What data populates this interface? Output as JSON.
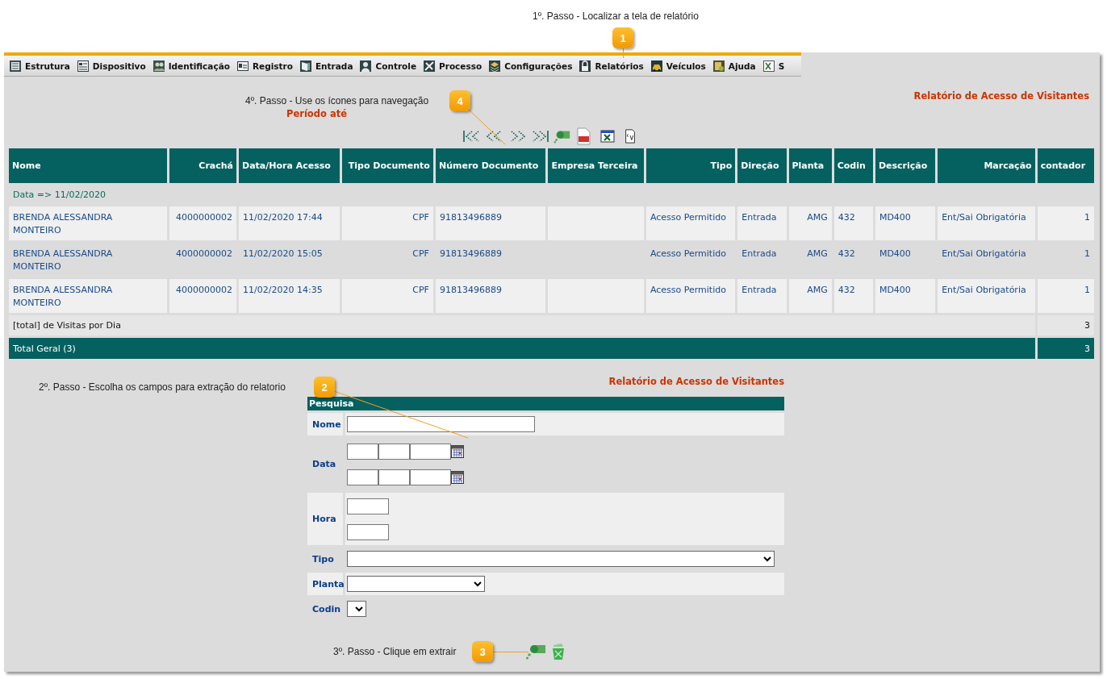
{
  "step_menu": {
    "text": "1º. Passo - Localizar a tela de relatório",
    "badge": "1"
  },
  "step_navigation": {
    "text": "4º. Passo - Use os ícones para navegação",
    "badge": "4"
  },
  "step_fields": {
    "text": "2º. Passo - Escolha os campos para extração do relatorio",
    "badge": "2"
  },
  "step_extract": {
    "text": "3º. Passo - Clique em extrair",
    "badge": "3"
  },
  "menu": {
    "items": [
      {
        "label": "Estrutura"
      },
      {
        "label": "Dispositivo"
      },
      {
        "label": "Identificação"
      },
      {
        "label": "Registro"
      },
      {
        "label": "Entrada"
      },
      {
        "label": "Controle"
      },
      {
        "label": "Processo"
      },
      {
        "label": "Configurações"
      },
      {
        "label": "Relatórios"
      },
      {
        "label": "Veículos"
      },
      {
        "label": "Ajuda"
      },
      {
        "label": "S"
      }
    ]
  },
  "report": {
    "title": "Relatório de Acesso de Visitantes",
    "period": "Período até",
    "table": {
      "columns": [
        "Nome",
        "Crachá",
        "Data/Hora Acesso",
        "Tipo Documento",
        "Número Documento",
        "Empresa Terceira",
        "Tipo",
        "Direção",
        "Planta",
        "Codin",
        "Descrição",
        "Marcação",
        "contador"
      ],
      "group": "Data => 11/02/2020",
      "rows": [
        [
          "BRENDA ALESSANDRA MONTEIRO",
          "4000000002",
          "11/02/2020 17:44",
          "CPF",
          "91813496889",
          "",
          "Acesso Permitido",
          "Entrada",
          "AMG",
          "432",
          "MD400",
          "Ent/Sai Obrigatória",
          "1"
        ],
        [
          "BRENDA ALESSANDRA MONTEIRO",
          "4000000002",
          "11/02/2020 15:05",
          "CPF",
          "91813496889",
          "",
          "Acesso Permitido",
          "Entrada",
          "AMG",
          "432",
          "MD400",
          "Ent/Sai Obrigatória",
          "1"
        ],
        [
          "BRENDA ALESSANDRA MONTEIRO",
          "4000000002",
          "11/02/2020 14:35",
          "CPF",
          "91813496889",
          "",
          "Acesso Permitido",
          "Entrada",
          "AMG",
          "432",
          "MD400",
          "Ent/Sai Obrigatória",
          "1"
        ]
      ],
      "day_total": {
        "label": "[total] de Visitas por Dia",
        "value": "3"
      },
      "grand_total": {
        "label": "Total Geral (3)",
        "value": "3"
      }
    }
  },
  "form": {
    "title": "Relatório de Acesso de Visitantes",
    "header": "Pesquisa",
    "fields": [
      {
        "label": "Nome",
        "kind": "text"
      },
      {
        "label": "Data",
        "kind": "daterange"
      },
      {
        "label": "Hora",
        "kind": "timerange"
      },
      {
        "label": "Tipo",
        "kind": "select"
      },
      {
        "label": "Planta",
        "kind": "select"
      },
      {
        "label": "Codin",
        "kind": "select"
      }
    ]
  }
}
